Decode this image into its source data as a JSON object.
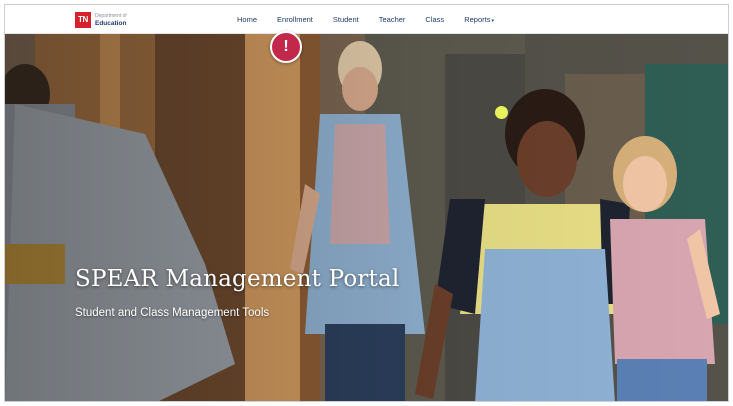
{
  "logo": {
    "mark": "TN",
    "subtitle": "Department of",
    "title": "Education",
    "brand_color": "#d6202b"
  },
  "nav": {
    "items": [
      {
        "label": "Home"
      },
      {
        "label": "Enrollment"
      },
      {
        "label": "Student"
      },
      {
        "label": "Teacher"
      },
      {
        "label": "Class"
      },
      {
        "label": "Reports"
      }
    ],
    "reports_caret": "▾",
    "text_color": "#1f3b6b"
  },
  "hero": {
    "title": "SPEAR Management Portal",
    "subtitle": "Student and Class Management Tools"
  },
  "alert": {
    "icon": "exclamation-icon",
    "glyph": "!",
    "color": "#c2284a"
  },
  "pointer": {
    "icon": "cursor-highlight-dot",
    "color": "#e8f25a"
  }
}
